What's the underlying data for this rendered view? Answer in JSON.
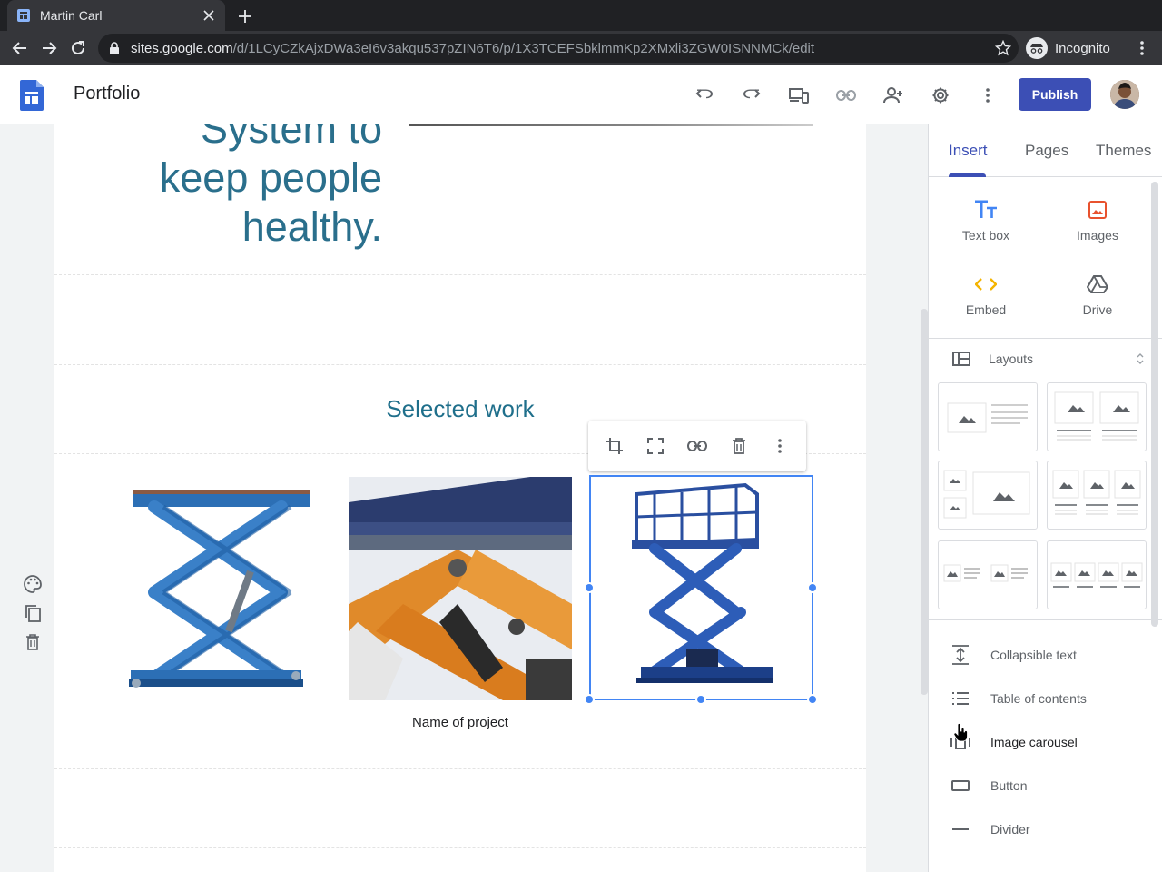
{
  "browser": {
    "tab_title": "Martin Carl",
    "url_host": "sites.google.com",
    "url_path": "/d/1LCyCZkAjxDWa3eI6v3akqu537pZIN6T6/p/1X3TCEFSbklmmKp2XMxli3ZGW0ISNNMCk/edit",
    "incognito_label": "Incognito"
  },
  "header": {
    "doc_title": "Portfolio",
    "publish_label": "Publish"
  },
  "page": {
    "hero_lines": [
      "System to",
      "keep people",
      "healthy."
    ],
    "section_title": "Selected work",
    "caption": "Name of project"
  },
  "panel": {
    "tabs": [
      "Insert",
      "Pages",
      "Themes"
    ],
    "insert_items": [
      {
        "label": "Text box",
        "icon": "text-box-icon"
      },
      {
        "label": "Images",
        "icon": "image-icon"
      },
      {
        "label": "Embed",
        "icon": "embed-icon"
      },
      {
        "label": "Drive",
        "icon": "drive-icon"
      }
    ],
    "layouts_label": "Layouts",
    "components": [
      {
        "label": "Collapsible text",
        "icon": "collapsible-text-icon"
      },
      {
        "label": "Table of contents",
        "icon": "table-of-contents-icon"
      },
      {
        "label": "Image carousel",
        "icon": "image-carousel-icon"
      },
      {
        "label": "Button",
        "icon": "button-icon"
      },
      {
        "label": "Divider",
        "icon": "divider-icon"
      }
    ]
  },
  "colors": {
    "accent": "#3c4fb5",
    "heading_teal": "#1f6f8b",
    "selection_blue": "#4285f4"
  }
}
